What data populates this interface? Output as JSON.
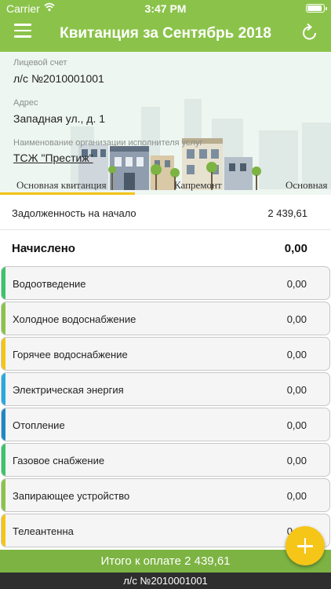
{
  "status_bar": {
    "carrier": "Carrier",
    "time": "3:47 PM"
  },
  "header": {
    "title": "Квитанция за Сентябрь 2018"
  },
  "account": {
    "label": "Лицевой счет",
    "value": "л/с №2010001001"
  },
  "address": {
    "label": "Адрес",
    "value": "Западная ул., д. 1"
  },
  "provider": {
    "label": "Наименование организации исполнителя услуг",
    "value": "ТСЖ \"Престиж\""
  },
  "tabs": [
    {
      "label": "Основная квитанция",
      "active": true
    },
    {
      "label": "Капремонт",
      "active": false
    },
    {
      "label": "Основная",
      "active": false
    }
  ],
  "debt": {
    "label": "Задолженность на начало",
    "value": "2 439,61"
  },
  "accrued": {
    "label": "Начислено",
    "value": "0,00"
  },
  "services": [
    {
      "label": "Водоотведение",
      "value": "0,00",
      "color": "#3cc36b"
    },
    {
      "label": "Холодное водоснабжение",
      "value": "0,00",
      "color": "#8bc34a"
    },
    {
      "label": "Горячее водоснабжение",
      "value": "0,00",
      "color": "#f5c518"
    },
    {
      "label": "Электрическая энергия",
      "value": "0,00",
      "color": "#29a9e0"
    },
    {
      "label": "Отопление",
      "value": "0,00",
      "color": "#1e88c9"
    },
    {
      "label": "Газовое снабжение",
      "value": "0,00",
      "color": "#3cc36b"
    },
    {
      "label": "Запирающее устройство",
      "value": "0,00",
      "color": "#8bc34a"
    },
    {
      "label": "Телеантенна",
      "value": "0,00",
      "color": "#f5c518"
    }
  ],
  "footer": {
    "total": "Итого к оплате 2 439,61",
    "account": "л/с №2010001001"
  },
  "colors": {
    "header": "#8bc34a",
    "tab_indicator": "#f2c318",
    "fab": "#f5c518"
  },
  "icons": {
    "menu": "hamburger-icon",
    "refresh": "refresh-icon",
    "add": "plus-icon",
    "wifi": "wifi-icon",
    "battery": "battery-icon"
  }
}
